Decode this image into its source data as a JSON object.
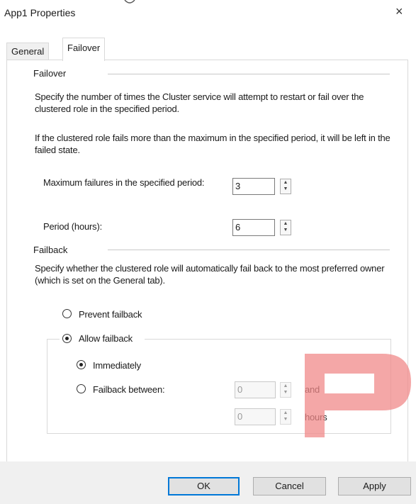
{
  "window": {
    "title": "App1 Properties",
    "close_glyph": "×"
  },
  "tabs": [
    {
      "label": "General",
      "selected": false
    },
    {
      "label": "Failover",
      "selected": true
    }
  ],
  "failover": {
    "heading": "Failover",
    "description1": "Specify the number of times the Cluster service will attempt to restart or fail over the clustered role in the specified period.",
    "description2": "If the clustered role fails more than the maximum in the specified period, it will be left in the failed state.",
    "max_failures_label": "Maximum failures in the specified period:",
    "max_failures_value": "3",
    "period_label": "Period (hours):",
    "period_value": "6"
  },
  "failback": {
    "heading": "Failback",
    "description": "Specify whether the clustered role will automatically fail back to the most preferred owner (which is set on the General tab).",
    "prevent_label": "Prevent failback",
    "allow_label": "Allow failback",
    "selected_option": "allow",
    "immediately_label": "Immediately",
    "between_label": "Failback between:",
    "timing_selected": "immediately",
    "between_start": "0",
    "between_and": "and",
    "between_end": "0",
    "between_hours": "hours"
  },
  "buttons": {
    "ok": "OK",
    "cancel": "Cancel",
    "apply": "Apply"
  },
  "colors": {
    "accent_focus": "#0078d7",
    "watermark": "#f08a8a"
  }
}
